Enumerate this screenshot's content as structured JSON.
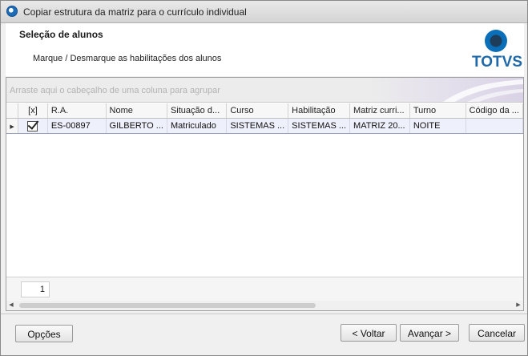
{
  "window": {
    "title": "Copiar estrutura da matriz para o currículo individual"
  },
  "header": {
    "title": "Seleção de alunos",
    "subtitle": "Marque / Desmarque as habilitações dos alunos",
    "logo_text": "TOTVS"
  },
  "grid": {
    "group_hint": "Arraste aqui o cabeçalho de uma coluna para agrupar",
    "columns": [
      "[x]",
      "R.A.",
      "Nome",
      "Situação d...",
      "Curso",
      "Habilitação",
      "Matriz curri...",
      "Turno",
      "Código da ..."
    ],
    "rows": [
      {
        "checked": true,
        "ra": "ES-00897",
        "nome": "GILBERTO ...",
        "situacao": "Matriculado",
        "curso": "SISTEMAS ...",
        "habilitacao": "SISTEMAS ...",
        "matriz": "MATRIZ 20...",
        "turno": "NOITE",
        "codigo": ""
      }
    ],
    "footer_count": "1"
  },
  "buttons": {
    "options": "Opções",
    "back": "< Voltar",
    "next": "Avançar >",
    "cancel": "Cancelar"
  },
  "colors": {
    "accent_blue": "#2069a8",
    "selected_row": "#eef0fb"
  }
}
